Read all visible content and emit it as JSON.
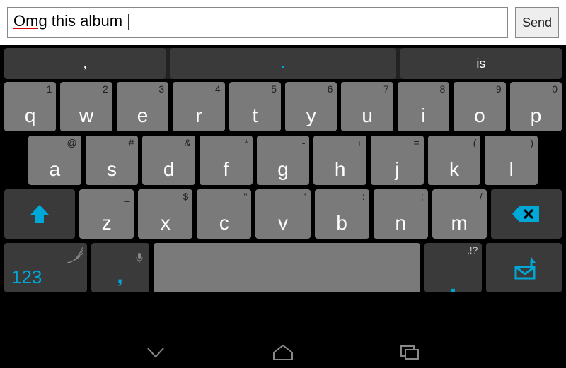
{
  "input": {
    "text_misspelled": "Omg",
    "text_rest": " this album ",
    "send_label": "Send"
  },
  "suggestions": {
    "left": ",",
    "center": ".",
    "right": "is"
  },
  "mode_label": "123",
  "punct_label": ",!?",
  "row1": [
    {
      "main": "q",
      "hint": "1"
    },
    {
      "main": "w",
      "hint": "2"
    },
    {
      "main": "e",
      "hint": "3"
    },
    {
      "main": "r",
      "hint": "4"
    },
    {
      "main": "t",
      "hint": "5"
    },
    {
      "main": "y",
      "hint": "6"
    },
    {
      "main": "u",
      "hint": "7"
    },
    {
      "main": "i",
      "hint": "8"
    },
    {
      "main": "o",
      "hint": "9"
    },
    {
      "main": "p",
      "hint": "0"
    }
  ],
  "row2": [
    {
      "main": "a",
      "hint": "@"
    },
    {
      "main": "s",
      "hint": "#"
    },
    {
      "main": "d",
      "hint": "&"
    },
    {
      "main": "f",
      "hint": "*"
    },
    {
      "main": "g",
      "hint": "-"
    },
    {
      "main": "h",
      "hint": "+"
    },
    {
      "main": "j",
      "hint": "="
    },
    {
      "main": "k",
      "hint": "("
    },
    {
      "main": "l",
      "hint": ")"
    }
  ],
  "row3": [
    {
      "main": "z",
      "hint": "_"
    },
    {
      "main": "x",
      "hint": "$"
    },
    {
      "main": "c",
      "hint": "\""
    },
    {
      "main": "v",
      "hint": "'"
    },
    {
      "main": "b",
      "hint": ":"
    },
    {
      "main": "n",
      "hint": ";"
    },
    {
      "main": "m",
      "hint": "/"
    }
  ],
  "colors": {
    "accent": "#00a8d8",
    "key": "#7a7a7a",
    "fn": "#3a3a3a"
  }
}
